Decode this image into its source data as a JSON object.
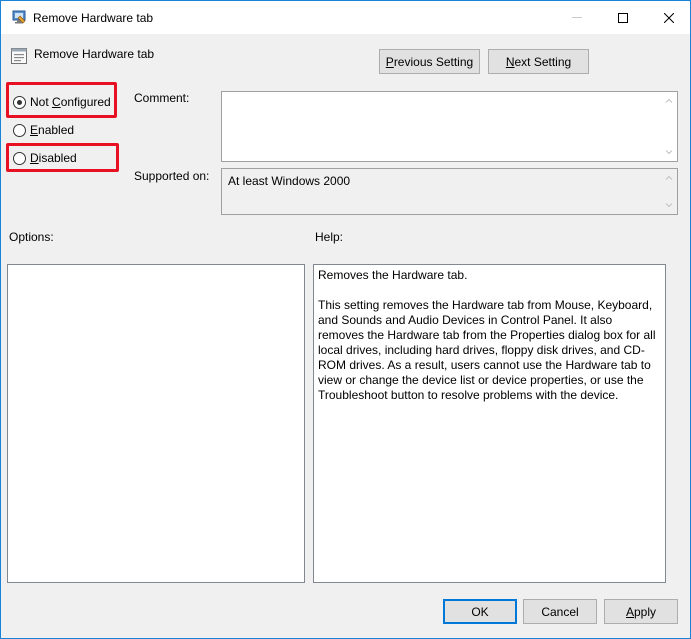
{
  "window": {
    "title": "Remove Hardware tab",
    "accent": "#1883d7"
  },
  "header": {
    "policy_name": "Remove Hardware tab"
  },
  "nav": {
    "previous": {
      "accel": "P",
      "rest": "revious Setting"
    },
    "next": {
      "accel": "N",
      "rest": "ext Setting"
    }
  },
  "state": {
    "options": [
      {
        "accel": "",
        "pre": "Not ",
        "accel2": "C",
        "rest": "onfigured",
        "checked": true
      },
      {
        "accel": "E",
        "rest": "nabled",
        "checked": false
      },
      {
        "accel": "D",
        "rest": "isabled",
        "checked": false
      }
    ],
    "highlight_color": "#e81123"
  },
  "comment": {
    "label": "Comment:",
    "value": ""
  },
  "supported": {
    "label": "Supported on:",
    "value": "At least Windows 2000"
  },
  "options_section": {
    "label": "Options:"
  },
  "help_section": {
    "label": "Help:",
    "paragraphs": [
      "Removes the Hardware tab.",
      "This setting removes the Hardware tab from Mouse, Keyboard, and Sounds and Audio Devices in Control Panel. It also removes the Hardware tab from the Properties dialog box for all local drives, including hard drives, floppy disk drives, and CD-ROM drives. As a result, users cannot use the Hardware tab to view or change the device list or device properties, or use the Troubleshoot button to resolve problems with the device."
    ]
  },
  "footer": {
    "ok": "OK",
    "cancel": "Cancel",
    "apply": {
      "accel": "A",
      "rest": "pply"
    }
  },
  "icons": {
    "title": "policy-window-icon",
    "header": "policy-setting-icon",
    "help": "help-icon",
    "maximize": "maximize-icon",
    "close": "close-icon"
  }
}
